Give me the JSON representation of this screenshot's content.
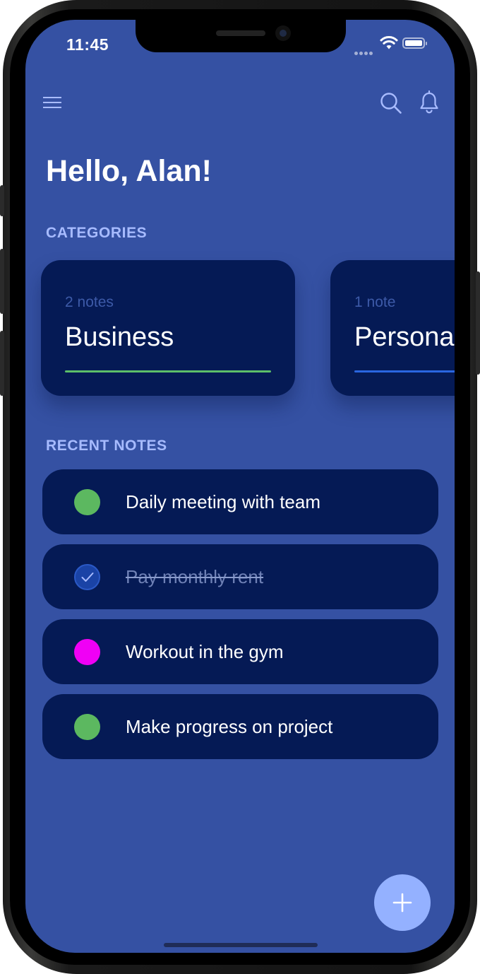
{
  "status_bar": {
    "time": "11:45"
  },
  "top_bar": {
    "menu_icon": "hamburger-menu-icon",
    "search_icon": "search-icon",
    "notifications_icon": "bell-icon"
  },
  "greeting": "Hello, Alan!",
  "categories": {
    "label": "CATEGORIES",
    "items": [
      {
        "count": "2 notes",
        "name": "Business",
        "accent": "#5cbf69"
      },
      {
        "count": "1 note",
        "name": "Personal",
        "accent": "#2a66e0"
      }
    ]
  },
  "recent_notes": {
    "label": "RECENT NOTES",
    "items": [
      {
        "text": "Daily meeting with team",
        "color": "#5cb860",
        "done": false
      },
      {
        "text": "Pay monthly rent",
        "color": "#1a43a6",
        "done": true
      },
      {
        "text": "Workout in the gym",
        "color": "#f000f5",
        "done": false
      },
      {
        "text": "Make progress on project",
        "color": "#5cb860",
        "done": false
      }
    ]
  },
  "fab": {
    "icon": "plus-icon"
  },
  "colors": {
    "background": "#3551a3",
    "card": "#051a55",
    "section_label": "#a7bbff",
    "fab": "#94b1ff"
  }
}
